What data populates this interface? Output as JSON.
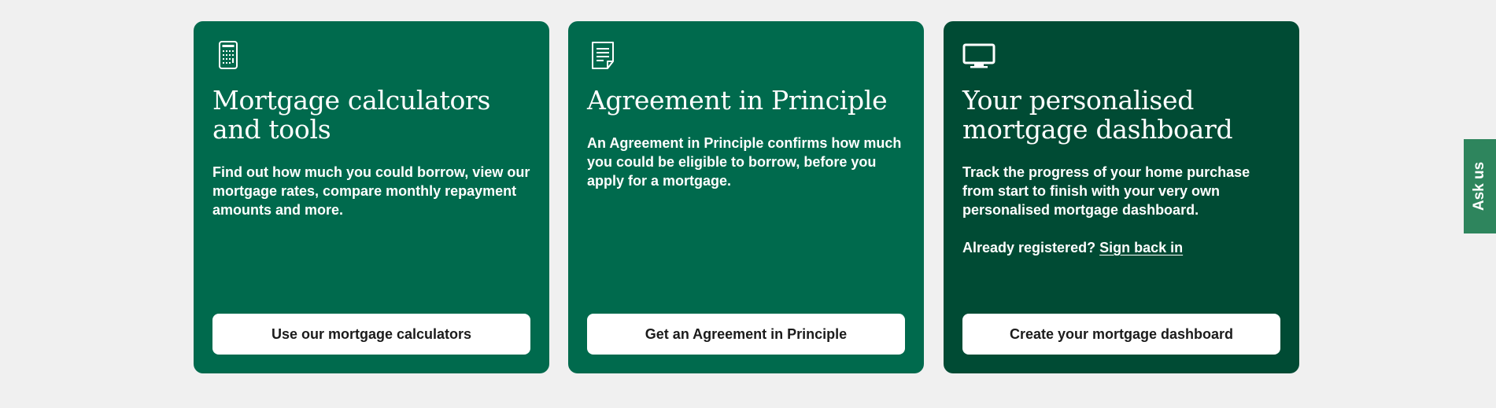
{
  "cards": [
    {
      "icon": "calculator-icon",
      "title": "Mortgage calculators and tools",
      "body": "Find out how much you could borrow, view our mortgage rates, compare monthly repayment amounts and more.",
      "button": "Use our mortgage calculators",
      "background": "#006a4d"
    },
    {
      "icon": "document-icon",
      "title": "Agreement in Principle",
      "body": "An Agreement in Principle confirms how much you could be eligible to borrow, before you apply for a mortgage.",
      "button": "Get an Agreement in Principle",
      "background": "#006a4d"
    },
    {
      "icon": "monitor-icon",
      "title": "Your personalised mortgage dashboard",
      "body": "Track the progress of your home purchase from start to finish with your very own personalised mortgage dashboard.",
      "registered_prefix": "Already registered?",
      "sign_in_link": "Sign back in",
      "button": "Create your mortgage dashboard",
      "background": "#004b34"
    }
  ],
  "ask_us": {
    "label": "Ask us",
    "color": "#2e855d"
  },
  "colors": {
    "page_background": "#f0f0f0",
    "button_text": "#1b1b1b"
  }
}
